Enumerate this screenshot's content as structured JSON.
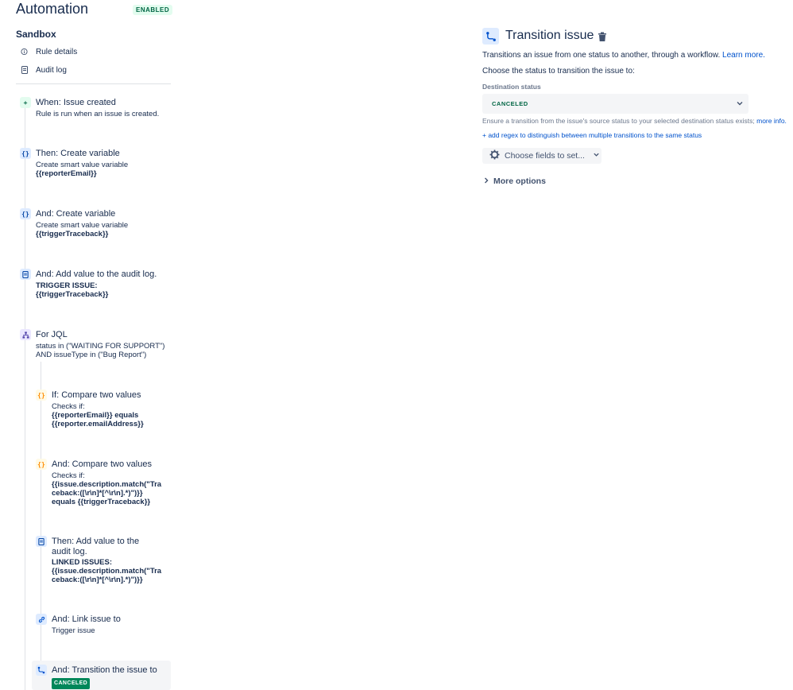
{
  "header": {
    "title": "Automation",
    "status_badge": "ENABLED",
    "project": "Sandbox"
  },
  "nav": {
    "items": [
      {
        "label": "Rule details",
        "icon": "info-icon"
      },
      {
        "label": "Audit log",
        "icon": "document-icon"
      }
    ]
  },
  "steps": [
    {
      "title": "When: Issue created",
      "desc": [
        "Rule is run when an issue is created."
      ],
      "bold": [],
      "icon": "plus-icon"
    },
    {
      "title": "Then: Create variable",
      "desc": [
        "Create smart value variable"
      ],
      "bold": [
        "{{reporterEmail}}"
      ],
      "icon": "braces-icon"
    },
    {
      "title": "And: Create variable",
      "desc": [
        "Create smart value variable"
      ],
      "bold": [
        "{{triggerTraceback}}"
      ],
      "icon": "braces-icon"
    },
    {
      "title": "And: Add value to the audit log.",
      "desc": [],
      "bold": [
        "TRIGGER ISSUE:",
        "{{triggerTraceback}}"
      ],
      "icon": "document-icon"
    },
    {
      "title": "For JQL",
      "desc": [
        "status in (\"WAITING FOR SUPPORT\")",
        "AND issueType in (\"Bug Report\")"
      ],
      "bold": [],
      "icon": "branch-icon"
    },
    {
      "title": "If: Compare two values",
      "desc": [
        "Checks if:"
      ],
      "bold": [
        "{{reporterEmail}} equals",
        "{{reporter.emailAddress}}"
      ],
      "icon": "braces-icon"
    },
    {
      "title": "And: Compare two values",
      "desc": [
        "Checks if:"
      ],
      "bold": [
        "{{issue.description.match(\"Tra",
        "ceback:([\\r\\n]*[^\\r\\n].*)\")}}",
        "equals {{triggerTraceback}}"
      ],
      "icon": "braces-icon"
    },
    {
      "title": "Then: Add value to the",
      "title2": "audit log.",
      "desc": [],
      "bold": [
        "LINKED ISSUES:",
        "{{issue.description.match(\"Tra",
        "ceback:([\\r\\n]*[^\\r\\n].*)\")}}"
      ],
      "icon": "document-icon"
    },
    {
      "title": "And: Link issue to",
      "desc": [
        "Trigger issue"
      ],
      "bold": [],
      "icon": "link-icon"
    },
    {
      "title": "And: Transition the issue to",
      "badge": "CANCELED",
      "icon": "transition-icon"
    }
  ],
  "panel": {
    "title": "Transition issue",
    "description": "Transitions an issue from one status to another, through a workflow.",
    "learn_more": "Learn more.",
    "choose_label": "Choose the status to transition the issue to:",
    "destination_label": "Destination status",
    "destination_value": "CANCELED",
    "ensure_text": "Ensure a transition from the issue's source status to your selected destination status exists;",
    "more_info": "more info.",
    "add_regex": "+ add regex to distinguish between multiple transitions to the same status",
    "choose_fields": "Choose fields to set...",
    "more_options": "More options"
  },
  "colors": {
    "accent": "#0052cc",
    "success": "#00875a",
    "text": "#172b4d"
  }
}
